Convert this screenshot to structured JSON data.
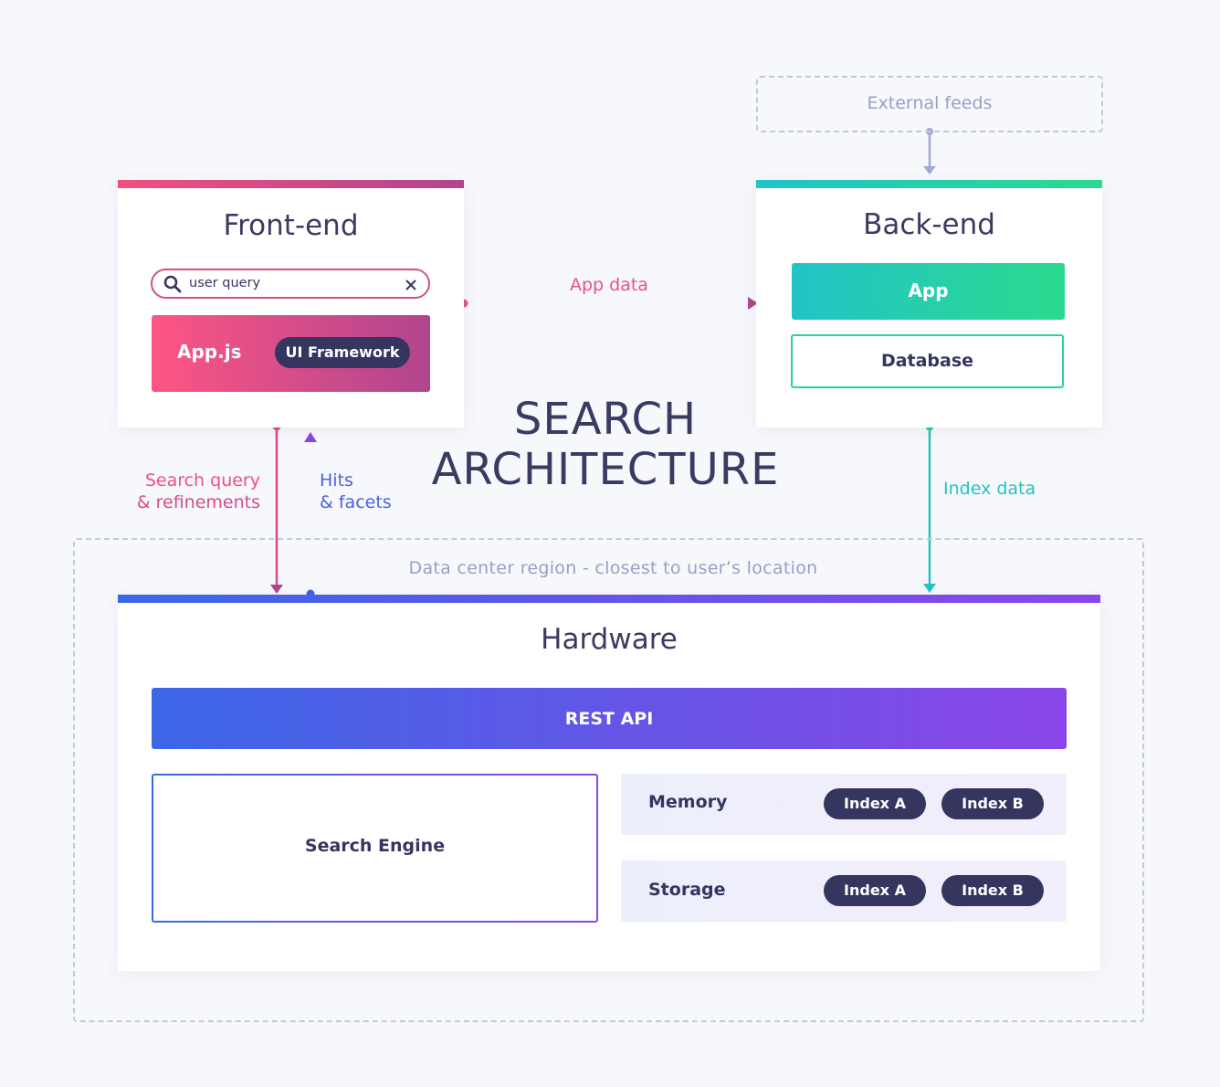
{
  "title": {
    "line1": "SEARCH",
    "line2": "ARCHITECTURE"
  },
  "external_feeds": "External feeds",
  "frontend": {
    "title": "Front-end",
    "search": {
      "value": "user query"
    },
    "appjs": "App.js",
    "ui_framework": "UI Framework"
  },
  "backend": {
    "title": "Back-end",
    "app": "App",
    "database": "Database"
  },
  "arrows": {
    "app_data": "App data",
    "search_query_1": "Search query",
    "search_query_2": "& refinements",
    "hits_1": "Hits",
    "hits_2": "& facets",
    "index_data": "Index data"
  },
  "region_label": "Data center region - closest to user’s location",
  "hardware": {
    "title": "Hardware",
    "rest_api": "REST API",
    "search_engine": "Search Engine",
    "memory": {
      "label": "Memory",
      "index_a": "Index A",
      "index_b": "Index B"
    },
    "storage": {
      "label": "Storage",
      "index_a": "Index A",
      "index_b": "Index B"
    }
  },
  "colors": {
    "pink": "#f0507e",
    "purple": "#b0458f",
    "teal": "#22c4c8",
    "green": "#2bd98e",
    "blue": "#3b67e6",
    "violet": "#8a45e8",
    "navy": "#35365f",
    "gray_arrow": "#a3a8d1"
  },
  "icons": {
    "search": "search-icon",
    "clear": "close-icon"
  }
}
